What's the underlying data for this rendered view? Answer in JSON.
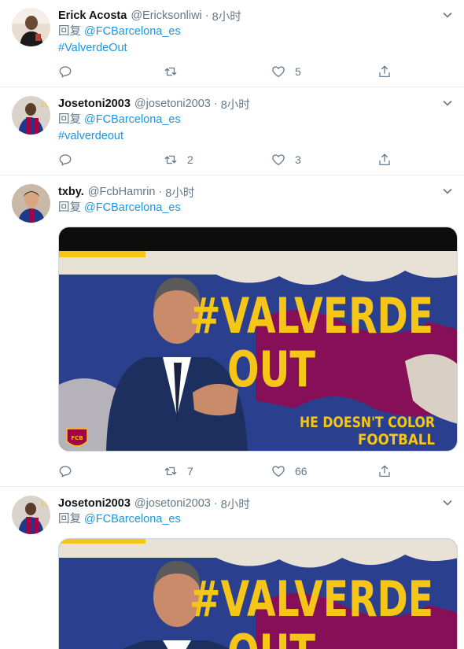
{
  "tweets": [
    {
      "name": "Erick Acosta",
      "handle": "@Ericksonliwi",
      "dot": "·",
      "time": "8小时",
      "replying_prefix": "回复 ",
      "replying_to": "@FCBarcelona_es",
      "hashtag": "#ValverdeOut",
      "reply_count": "",
      "retweet_count": "",
      "like_count": "5"
    },
    {
      "name": "Josetoni2003",
      "handle": "@josetoni2003",
      "dot": "·",
      "time": "8小时",
      "replying_prefix": "回复 ",
      "replying_to": "@FCBarcelona_es",
      "hashtag": "#valverdeout",
      "reply_count": "",
      "retweet_count": "2",
      "like_count": "3"
    },
    {
      "name": "txby.",
      "handle": "@FcbHamrin",
      "dot": "·",
      "time": "8小时",
      "replying_prefix": "回复 ",
      "replying_to": "@FCBarcelona_es",
      "reply_count": "",
      "retweet_count": "7",
      "like_count": "66",
      "media": {
        "headline_line1": "#VALVERDE",
        "headline_line2": "OUT",
        "tagline_line1": "HE DOESN'T COLOR",
        "tagline_line2": "FOOTBALL",
        "crest_text": "FCB"
      }
    },
    {
      "name": "Josetoni2003",
      "handle": "@josetoni2003",
      "dot": "·",
      "time": "8小时",
      "replying_prefix": "回复 ",
      "replying_to": "@FCBarcelona_es",
      "media": {
        "headline_line1": "#VALVERDE",
        "headline_line2": "OUT"
      }
    }
  ],
  "colors": {
    "link": "#1b95e0",
    "secondary_text": "#657786",
    "headline_yellow": "#f5c518",
    "barca_blue": "#1d3a8a",
    "barca_red": "#a50044"
  },
  "icons": [
    "reply-icon",
    "retweet-icon",
    "like-icon",
    "share-icon",
    "chevron-down-icon"
  ]
}
